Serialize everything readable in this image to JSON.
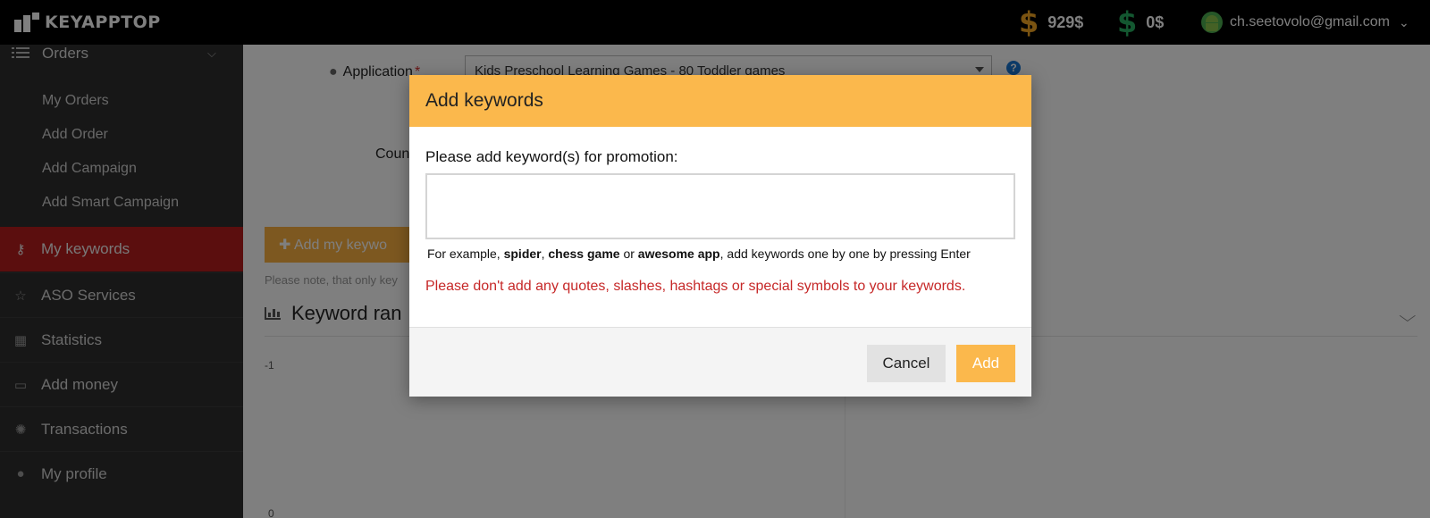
{
  "brand": {
    "name": "KEYAPPTOP"
  },
  "header": {
    "balances": [
      {
        "currency_symbol": "$",
        "amount": "929$",
        "color": "#f5a623"
      },
      {
        "currency_symbol": "$",
        "amount": "0$",
        "color": "#27ae60"
      }
    ],
    "user": {
      "email": "ch.seetovolo@gmail.com"
    }
  },
  "sidebar": {
    "orders": {
      "label": "Orders",
      "subitems": [
        "My Orders",
        "Add Order",
        "Add Campaign",
        "Add Smart Campaign"
      ]
    },
    "items": [
      {
        "label": "My keywords",
        "icon": "key-icon",
        "active": true
      },
      {
        "label": "ASO Services",
        "icon": "star-icon"
      },
      {
        "label": "Statistics",
        "icon": "table-icon"
      },
      {
        "label": "Add money",
        "icon": "money-icon"
      },
      {
        "label": "Transactions",
        "icon": "spinner-icon"
      },
      {
        "label": "My profile",
        "icon": "user-icon"
      }
    ]
  },
  "main": {
    "application_label": "Application",
    "application_value": "Kids Preschool Learning Games - 80 Toddler games",
    "help_icon": "?",
    "country_label": "Coun",
    "add_button_label": "✚ Add my keywo",
    "note": "Please note, that only key",
    "section_title": "Keyword ran",
    "y_tick_top": "-1",
    "y_tick_bottom": "0"
  },
  "modal": {
    "title": "Add keywords",
    "prompt": "Please add keyword(s) for promotion:",
    "input_value": "",
    "hint": {
      "prefix": "For example, ",
      "ex1": "spider",
      "sep": ", ",
      "ex2": "chess game",
      "or": " or ",
      "ex3": "awesome app",
      "suffix": ", add keywords one by one by pressing Enter"
    },
    "warning": "Please don't add any quotes, slashes, hashtags or special symbols to your keywords.",
    "cancel_label": "Cancel",
    "add_label": "Add"
  },
  "colors": {
    "accent": "#fbb84c",
    "active_nav": "#b71c1c",
    "warning": "#c62828",
    "sidebar_bg": "#2e2e2e"
  }
}
